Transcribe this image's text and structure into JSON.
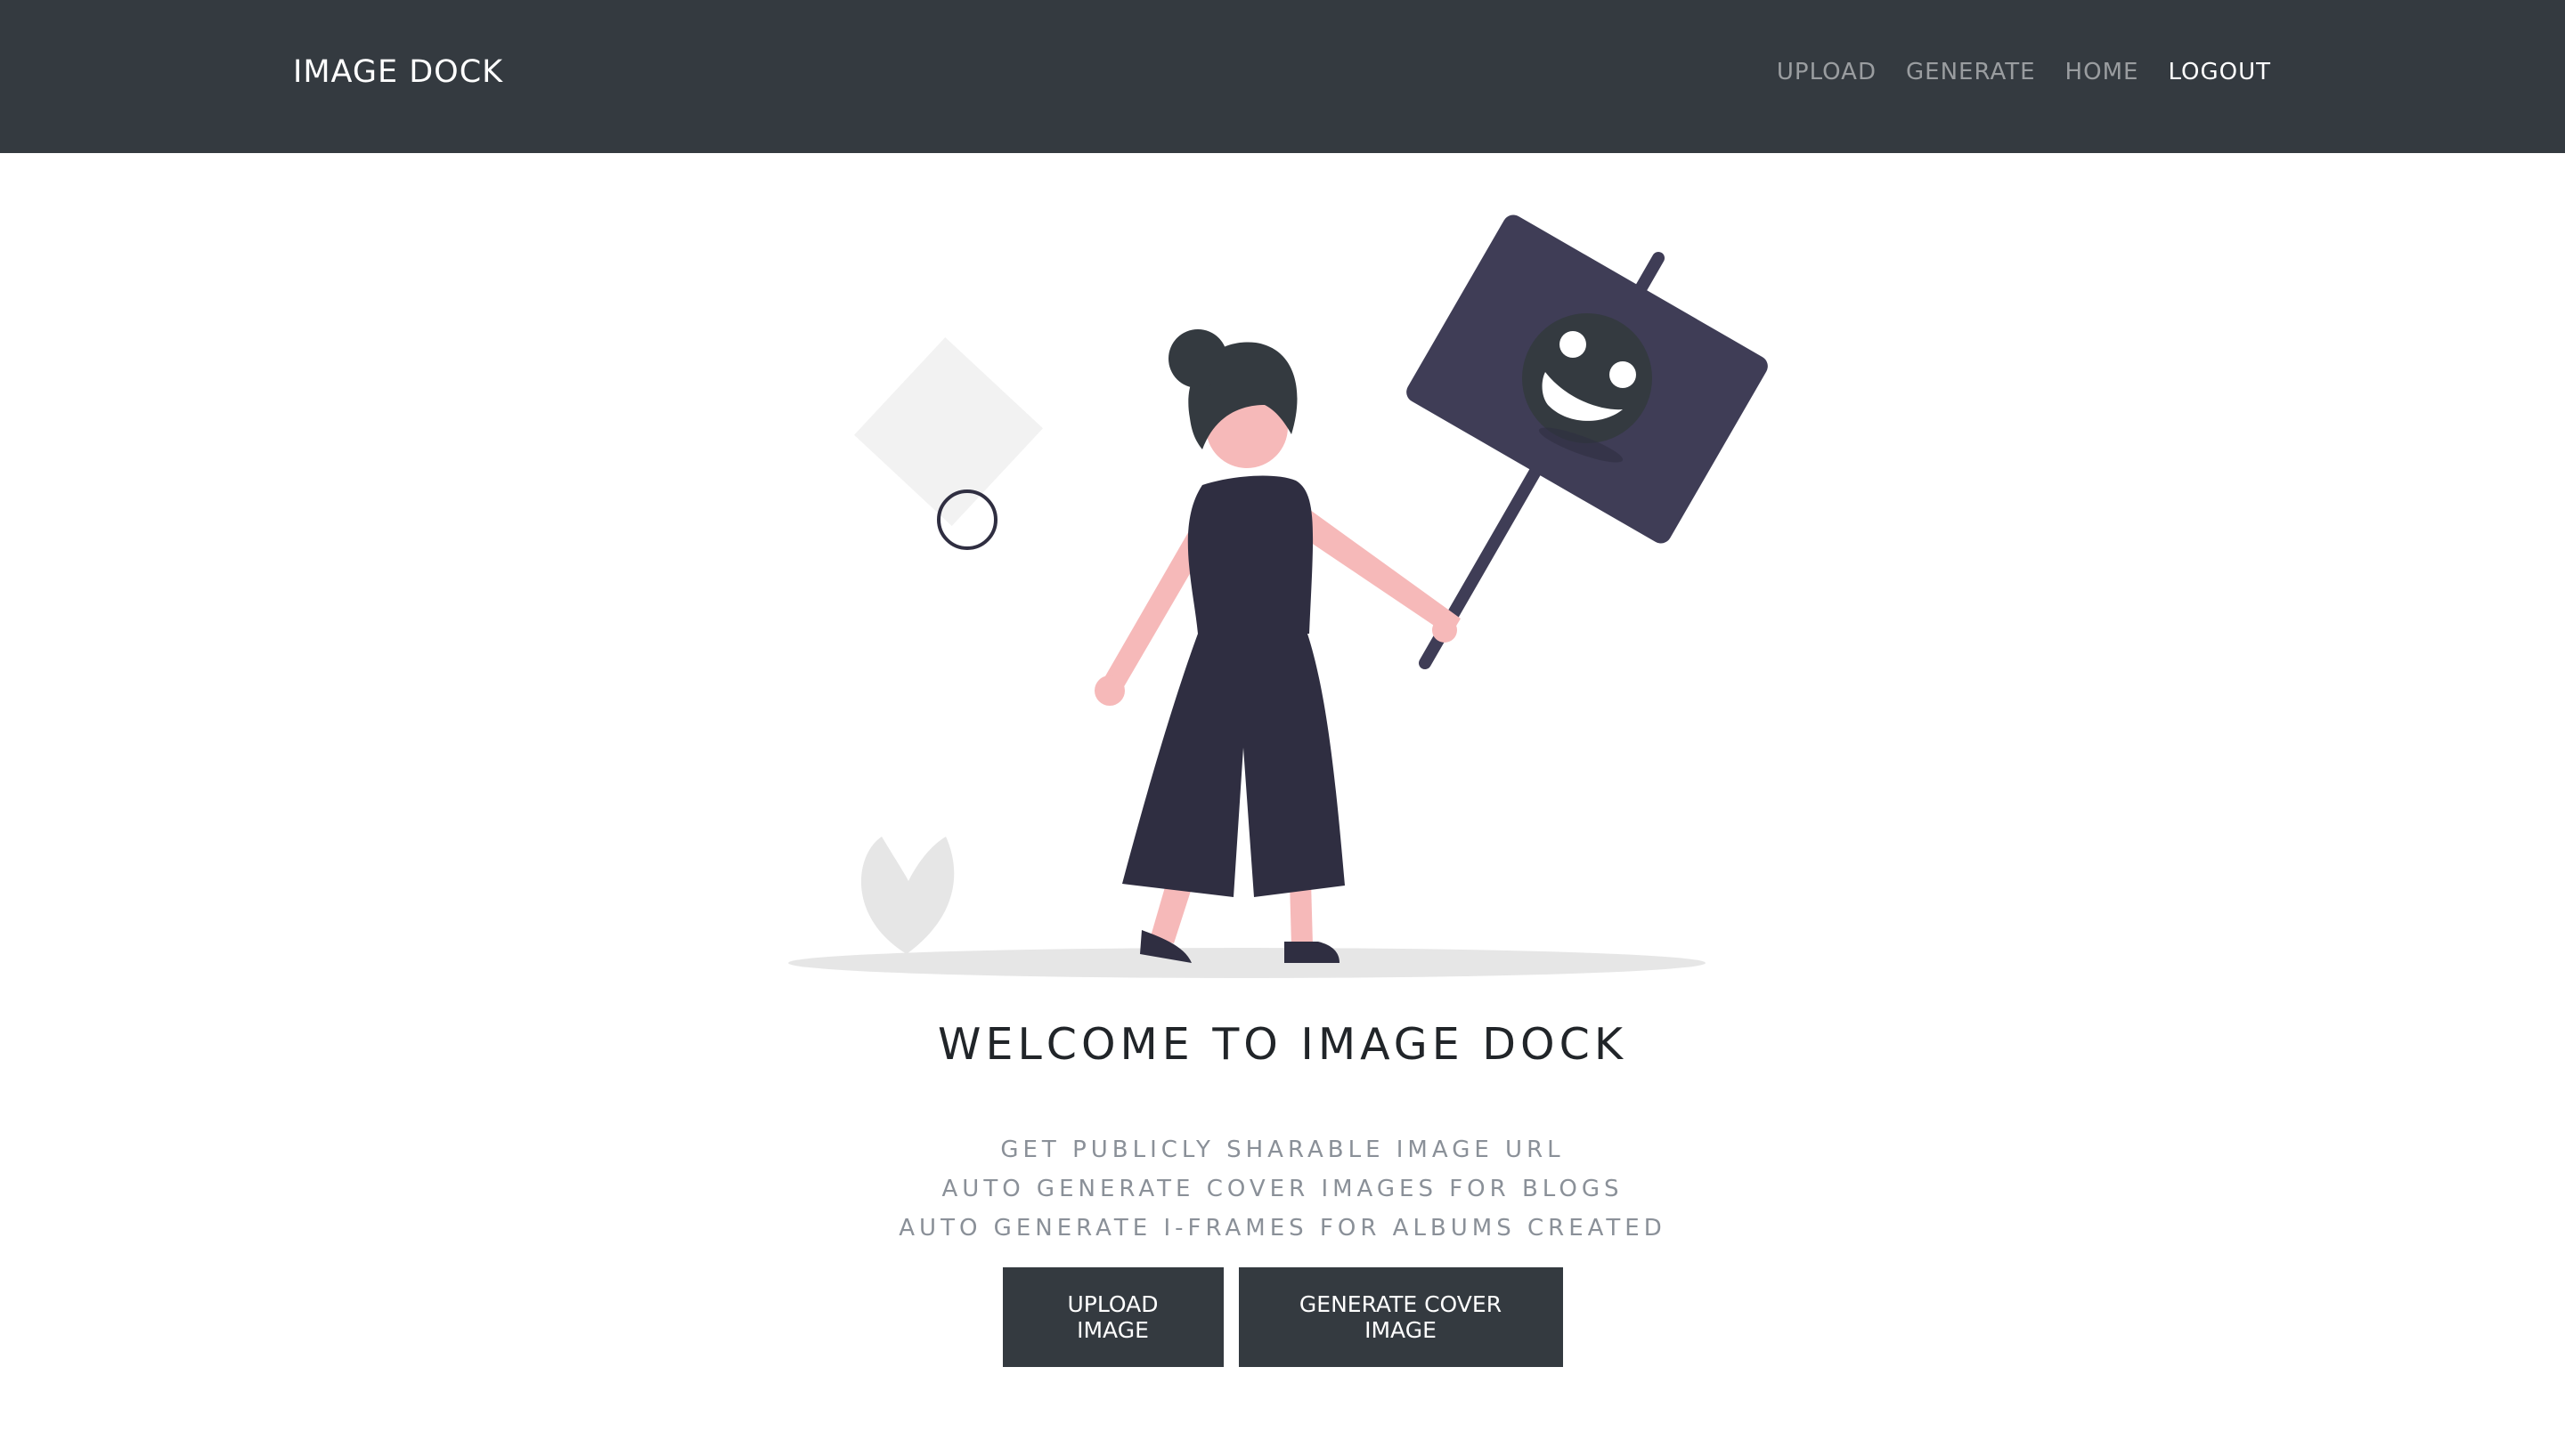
{
  "navbar": {
    "brand": "IMAGE DOCK",
    "links": [
      {
        "label": "UPLOAD"
      },
      {
        "label": "GENERATE"
      },
      {
        "label": "HOME"
      },
      {
        "label": "LOGOUT"
      }
    ],
    "colors": {
      "background": "#343a40",
      "text": "#ffffff"
    }
  },
  "hero": {
    "title": "WELCOME TO IMAGE DOCK",
    "features": [
      "GET PUBLICLY SHARABLE IMAGE URL",
      "AUTO GENERATE COVER IMAGES FOR BLOGS",
      "AUTO GENERATE I-FRAMES FOR ALBUMS CREATED"
    ],
    "buttons": {
      "upload": "UPLOAD IMAGE",
      "generate": "GENERATE COVER IMAGE"
    },
    "illustration": "woman-holding-smiley-sign"
  },
  "colors": {
    "dark": "#2f2e41",
    "skin": "#f6b9b9",
    "hair": "#343a40",
    "sign": "#3f3d56",
    "light_gray": "#e6e6e6"
  }
}
